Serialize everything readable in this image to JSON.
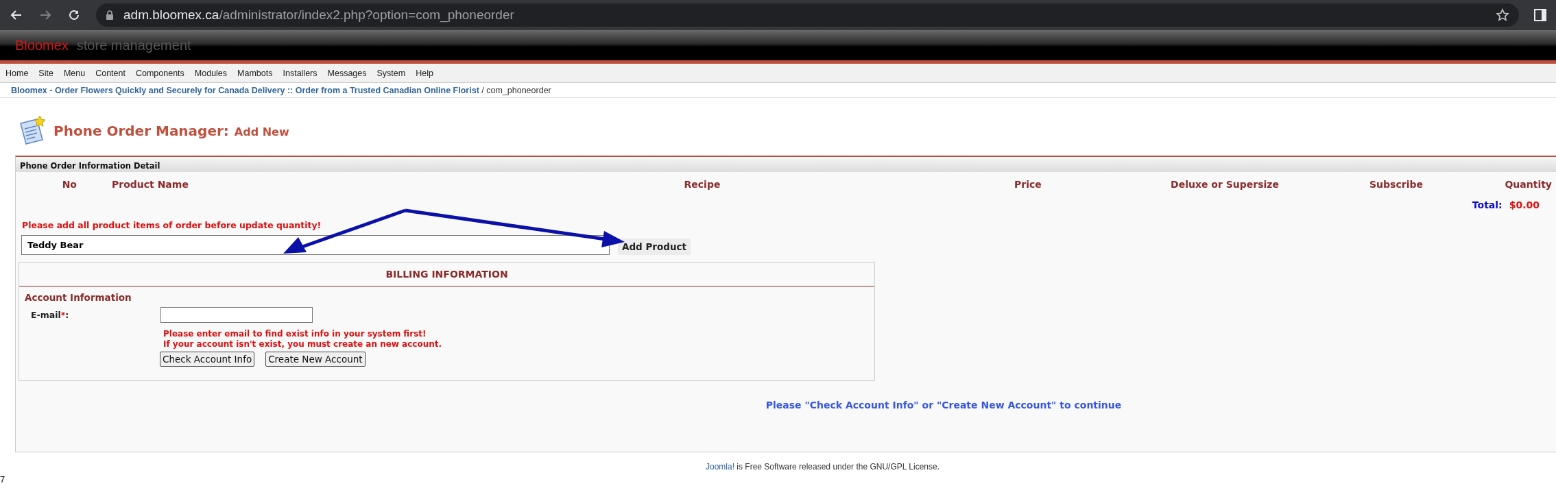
{
  "browser": {
    "url_host": "adm.bloomex.ca",
    "url_path": "/administrator/index2.php?option=com_phoneorder"
  },
  "header": {
    "brand": "Bloomex",
    "tagline": "store management"
  },
  "menu": [
    "Home",
    "Site",
    "Menu",
    "Content",
    "Components",
    "Modules",
    "Mambots",
    "Installers",
    "Messages",
    "System",
    "Help"
  ],
  "breadcrumb": {
    "link": "Bloomex - Order Flowers Quickly and Securely for Canada Delivery :: Order from a Trusted Canadian Online Florist",
    "rest": " / com_phoneorder"
  },
  "page_title": {
    "main": "Phone Order Manager:",
    "sub": "Add New"
  },
  "panel": {
    "title": "Phone Order Information Detail",
    "columns": [
      "No",
      "Product Name",
      "Recipe",
      "Price",
      "Deluxe or Supersize",
      "Subscribe",
      "Quantity"
    ],
    "total_label": "Total:",
    "total_value": "$0.00",
    "warning": "Please add all product items of order before update quantity!",
    "product_field": {
      "value": "Teddy Bear"
    },
    "add_button": "Add Product",
    "billing": {
      "title": "BILLING INFORMATION",
      "section": "Account Information",
      "email_label": "E-mail",
      "required_mark": "*",
      "colon": ":",
      "hint": [
        "Please enter email to find exist info in your system first!",
        "If your account isn't exist, you must create an new account."
      ],
      "buttons": [
        "Check Account Info",
        "Create New Account"
      ]
    },
    "continue_note": "Please \"Check Account Info\" or \"Create New Account\" to continue"
  },
  "footer": {
    "link": "Joomla!",
    "text": " is Free Software released under the GNU/GPL License."
  },
  "stray_text": "7"
}
